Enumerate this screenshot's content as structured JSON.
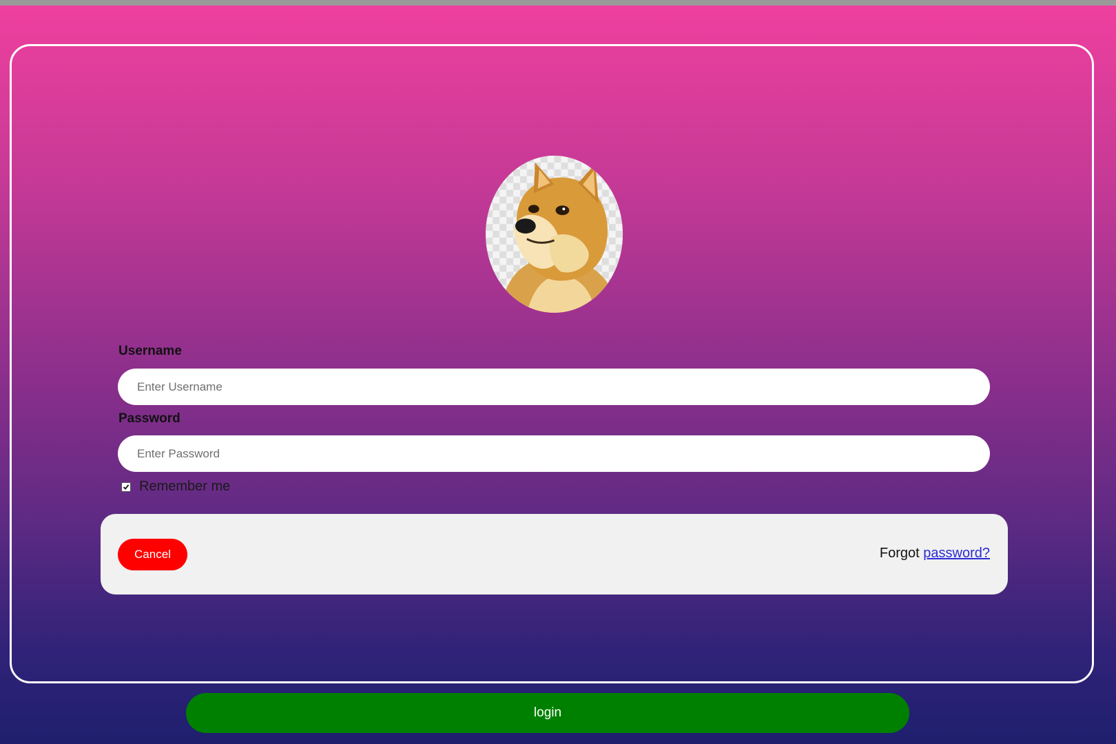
{
  "form": {
    "username_label": "Username",
    "username_placeholder": "Enter Username",
    "username_value": "",
    "password_label": "Password",
    "password_placeholder": "Enter Password",
    "password_value": "",
    "remember_label": "Remember me",
    "remember_checked": true
  },
  "actions": {
    "cancel_label": "Cancel",
    "forgot_text": "Forgot",
    "forgot_link": "password?",
    "login_label": "login"
  },
  "avatar": {
    "icon": "doge-avatar-icon"
  },
  "colors": {
    "gradient_top": "#f0409f",
    "gradient_bottom": "#1f1f6e",
    "cancel": "#ff0000",
    "login": "#008000",
    "link": "#2b2bd6",
    "panel": "#f1f1f1"
  }
}
